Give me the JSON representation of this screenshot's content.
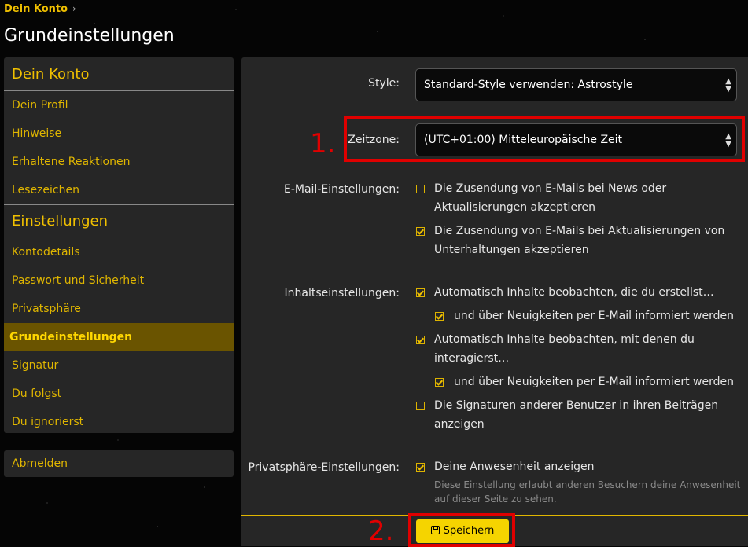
{
  "breadcrumb": {
    "label": "Dein Konto"
  },
  "page_title": "Grundeinstellungen",
  "sidebar": {
    "section1": "Dein Konto",
    "items1": [
      "Dein Profil",
      "Hinweise",
      "Erhaltene Reaktionen",
      "Lesezeichen"
    ],
    "section2": "Einstellungen",
    "items2": [
      "Kontodetails",
      "Passwort und Sicherheit",
      "Privatsphäre",
      "Grundeinstellungen",
      "Signatur",
      "Du folgst",
      "Du ignorierst"
    ],
    "active": "Grundeinstellungen",
    "logout": "Abmelden"
  },
  "form": {
    "style_label": "Style:",
    "style_value": "Standard-Style verwenden: Astrostyle",
    "timezone_label": "Zeitzone:",
    "timezone_value": "(UTC+01:00) Mitteleuropäische Zeit",
    "email_label": "E-Mail-Einstellungen:",
    "email_opt1": "Die Zusendung von E-Mails bei News oder Aktualisierungen akzeptieren",
    "email_opt2": "Die Zusendung von E-Mails bei Aktualisierungen von Unterhaltungen akzeptieren",
    "content_label": "Inhaltseinstellungen:",
    "content_opt1": "Automatisch Inhalte beobachten, die du erstellst…",
    "content_opt1_sub": "und über Neuigkeiten per E-Mail informiert werden",
    "content_opt2": "Automatisch Inhalte beobachten, mit denen du interagierst…",
    "content_opt2_sub": "und über Neuigkeiten per E-Mail informiert werden",
    "content_opt3": "Die Signaturen anderer Benutzer in ihren Beiträgen anzeigen",
    "privacy_label": "Privatsphäre-Einstellungen:",
    "privacy_opt1": "Deine Anwesenheit anzeigen",
    "privacy_hint": "Diese Einstellung erlaubt anderen Besuchern deine Anwesenheit auf dieser Seite zu sehen.",
    "save_label": "Speichern"
  },
  "annotations": {
    "n1": "1.",
    "n2": "2."
  },
  "colors": {
    "accent": "#f0c000",
    "highlight": "#e00000",
    "active_bg": "#6a5400",
    "save_bg": "#f5d400"
  },
  "icons": {
    "breadcrumb": "chevron-right-icon",
    "select": "updown-arrows-icon",
    "save": "floppy-disk-icon"
  }
}
